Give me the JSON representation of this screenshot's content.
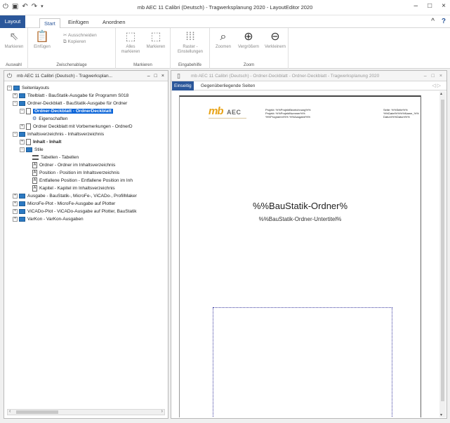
{
  "window": {
    "title": "mb AEC 11 Calibri (Deutsch) - Tragwerksplanung 2020 - LayoutEditor 2020",
    "controls": [
      "–",
      "□",
      "×"
    ]
  },
  "qat": {
    "app_icon": "power-icon",
    "save": "save-icon",
    "undo": "undo-icon",
    "redo": "redo-icon"
  },
  "ribbon": {
    "tabs": [
      {
        "label": "Layout"
      },
      {
        "label": "Start"
      },
      {
        "label": "Einfügen"
      },
      {
        "label": "Anordnen"
      }
    ],
    "collapse": "^",
    "help": "?",
    "groups": {
      "auswahl": {
        "label": "Auswahl",
        "markieren": "Markieren"
      },
      "zwischenablage": {
        "label": "Zwischenablage",
        "einfuegen": "Einfügen",
        "ausschneiden": "Ausschneiden",
        "kopieren": "Kopieren"
      },
      "markieren": {
        "label": "Markieren",
        "alles_markieren_1": "Alles",
        "alles_markieren_2": "markieren",
        "markieren_btn": "Markieren"
      },
      "eingabehilfe": {
        "label": "Eingabehilfe",
        "raster_1": "Raster -",
        "raster_2": "Einstellungen"
      },
      "zoom": {
        "label": "Zoom",
        "zoomen": "Zoomen",
        "vergroessern": "Vergrößern",
        "verkleinern": "Verkleinern"
      }
    }
  },
  "left_panel": {
    "title": "mb AEC 11 Calibri (Deutsch) - Tragwerksplan...",
    "tree": [
      {
        "label": "Seitenlayouts"
      },
      {
        "label": "Titelblatt - BauStatik-Ausgabe für Programm S018"
      },
      {
        "label": "Ordner-Deckblatt - BauStatik-Ausgabe für Ordner"
      },
      {
        "label": "Ordner-Deckblatt - OrdnerDeckblatt"
      },
      {
        "label": "Eigenschaften"
      },
      {
        "label": "Ordner Deckblatt mit Vorbemerkungen - OrdnerD"
      },
      {
        "label": "Inhaltsverzeichnis - Inhaltsverzeichnis"
      },
      {
        "label": "Inhalt - Inhalt"
      },
      {
        "label": "Stile"
      },
      {
        "label": "Tabellen - Tabellen"
      },
      {
        "label": "Ordner - Ordner im Inhaltsverzeichnis"
      },
      {
        "label": "Position - Position im Inhaltsverzeichnis"
      },
      {
        "label": "Entfallene Position - Entfallene Position im Inh"
      },
      {
        "label": "Kapitel - Kapitel im Inhaltsverzeichnis"
      },
      {
        "label": "Ausgabe - BauStatik-, MicroFe-, ViCADo-, ProfilMaker"
      },
      {
        "label": "MicroFe-Plot - MicroFe-Ausgabe auf Plotter"
      },
      {
        "label": "ViCADo-Plot - ViCADo-Ausgabe auf Plotter, BauStatik"
      },
      {
        "label": "VarKon - VarKon-Ausgaben"
      }
    ]
  },
  "right_panel": {
    "title": "mb AEC 11 Calibri (Deutsch) - Ordner-Deckblatt - Ordner-Deckblatt - Tragwerksplanung 2020",
    "tabs": [
      "Einseitig",
      "Gegenüberliegende Seiten"
    ],
    "nav": "◁ ▷",
    "document": {
      "logo_mb": "mb",
      "logo_aec": "AEC",
      "header_left": [
        "Projekt: %%ProjektBezeichnung%%",
        "Projekt: %%ProjektNummer%%",
        "%%Programm%% %%Ausgabe%%"
      ],
      "header_right": [
        "Seite: %%Seite%%",
        "%%Datei%%%%Name_%%",
        "Datum%%Datum%%"
      ],
      "title": "%%BauStatik-Ordner%",
      "subtitle": "%%BauStatik-Ordner-Untertitel%"
    }
  }
}
